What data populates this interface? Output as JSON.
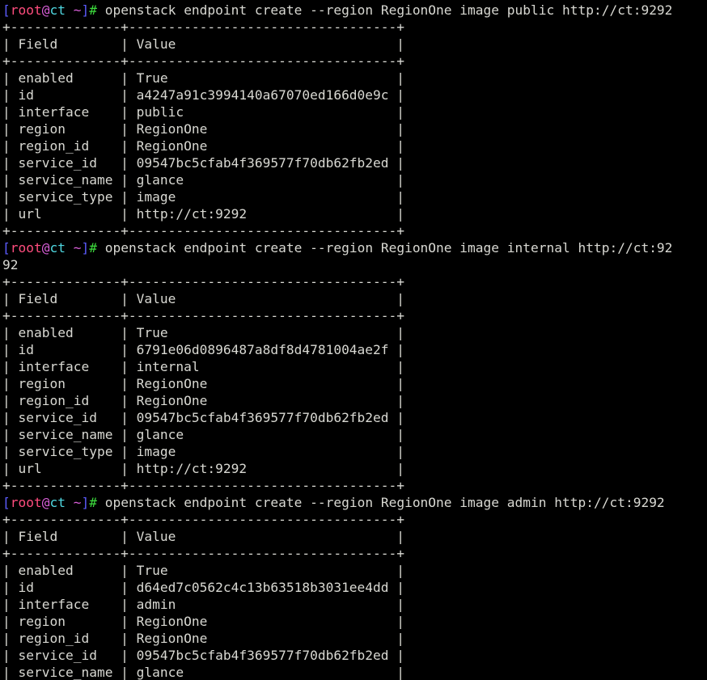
{
  "terminal": {
    "title": "root@ct:~",
    "background_color": "#000000",
    "foreground_color": "#d8d8d2",
    "font_size_px": 16,
    "line_height_px": 21,
    "columns": 85,
    "prompt": {
      "open_bracket": "[",
      "user": "root",
      "at": "@",
      "host": "ct",
      "space": " ",
      "path": "~",
      "close_bracket": "]",
      "sigil": "#",
      "trailing_space": " ",
      "colors": {
        "bracket": "#5c5cff",
        "user": "#ff4d7e",
        "at": "#d95fd9",
        "host": "#4fd7e0",
        "path": "#d95fd9",
        "sigil": "#3ddb3d"
      }
    },
    "table": {
      "separator": "+--------------+----------------------------------+",
      "headers": [
        "Field",
        "Value"
      ],
      "header_row": "| Field        | Value                            |"
    },
    "blocks": [
      {
        "command": "openstack endpoint create --region RegionOne image public http://ct:9292",
        "command_lines": [
          "openstack endpoint create --region RegionOne image public http://ct:9292"
        ],
        "rows": [
          {
            "field": "enabled",
            "value": "True"
          },
          {
            "field": "id",
            "value": "a4247a91c3994140a67070ed166d0e9c"
          },
          {
            "field": "interface",
            "value": "public"
          },
          {
            "field": "region",
            "value": "RegionOne"
          },
          {
            "field": "region_id",
            "value": "RegionOne"
          },
          {
            "field": "service_id",
            "value": "09547bc5cfab4f369577f70db62fb2ed"
          },
          {
            "field": "service_name",
            "value": "glance"
          },
          {
            "field": "service_type",
            "value": "image"
          },
          {
            "field": "url",
            "value": "http://ct:9292"
          }
        ],
        "truncated": false
      },
      {
        "command": "openstack endpoint create --region RegionOne image internal http://ct:9292",
        "command_lines": [
          "openstack endpoint create --region RegionOne image internal http://ct:92",
          "92"
        ],
        "rows": [
          {
            "field": "enabled",
            "value": "True"
          },
          {
            "field": "id",
            "value": "6791e06d0896487a8df8d4781004ae2f"
          },
          {
            "field": "interface",
            "value": "internal"
          },
          {
            "field": "region",
            "value": "RegionOne"
          },
          {
            "field": "region_id",
            "value": "RegionOne"
          },
          {
            "field": "service_id",
            "value": "09547bc5cfab4f369577f70db62fb2ed"
          },
          {
            "field": "service_name",
            "value": "glance"
          },
          {
            "field": "service_type",
            "value": "image"
          },
          {
            "field": "url",
            "value": "http://ct:9292"
          }
        ],
        "truncated": false
      },
      {
        "command": "openstack endpoint create --region RegionOne image admin http://ct:9292",
        "command_lines": [
          "openstack endpoint create --region RegionOne image admin http://ct:9292"
        ],
        "rows": [
          {
            "field": "enabled",
            "value": "True"
          },
          {
            "field": "id",
            "value": "d64ed7c0562c4c13b63518b3031ee4dd"
          },
          {
            "field": "interface",
            "value": "admin"
          },
          {
            "field": "region",
            "value": "RegionOne"
          },
          {
            "field": "region_id",
            "value": "RegionOne"
          },
          {
            "field": "service_id",
            "value": "09547bc5cfab4f369577f70db62fb2ed"
          },
          {
            "field": "service_name",
            "value": "glance"
          }
        ],
        "truncated": true
      }
    ]
  }
}
